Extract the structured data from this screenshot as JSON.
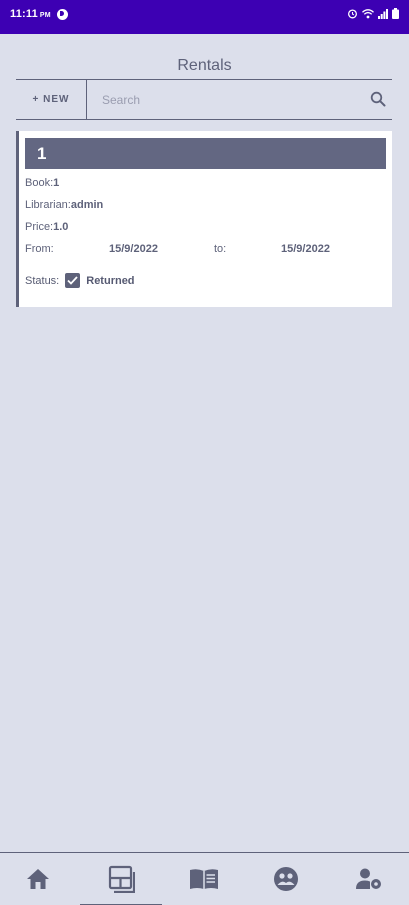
{
  "status_bar": {
    "time": "11:11",
    "ampm": "PM",
    "icons": [
      "alarm-icon",
      "wifi-icon",
      "signal-icon",
      "battery-icon"
    ]
  },
  "page": {
    "title": "Rentals"
  },
  "toolbar": {
    "new_label": "+ NEW",
    "search_placeholder": "Search",
    "search_value": ""
  },
  "rentals": [
    {
      "id": "1",
      "book_label": "Book:",
      "book_value": "1",
      "librarian_label": "Librarian:",
      "librarian_value": "admin",
      "price_label": "Price:",
      "price_value": "1.0",
      "from_label": "From:",
      "from_value": "15/9/2022",
      "to_label": "to:",
      "to_value": "15/9/2022",
      "status_label": "Status:",
      "status_value": "Returned",
      "returned": true
    }
  ],
  "bottom_nav": {
    "items": [
      "home-icon",
      "rentals-icon",
      "books-icon",
      "community-icon",
      "user-settings-icon"
    ],
    "selected": "rentals-icon"
  },
  "colors": {
    "status_bar": "#3d00b3",
    "background": "#dcdfeb",
    "accent": "#5e627a",
    "card_header": "#636782"
  }
}
